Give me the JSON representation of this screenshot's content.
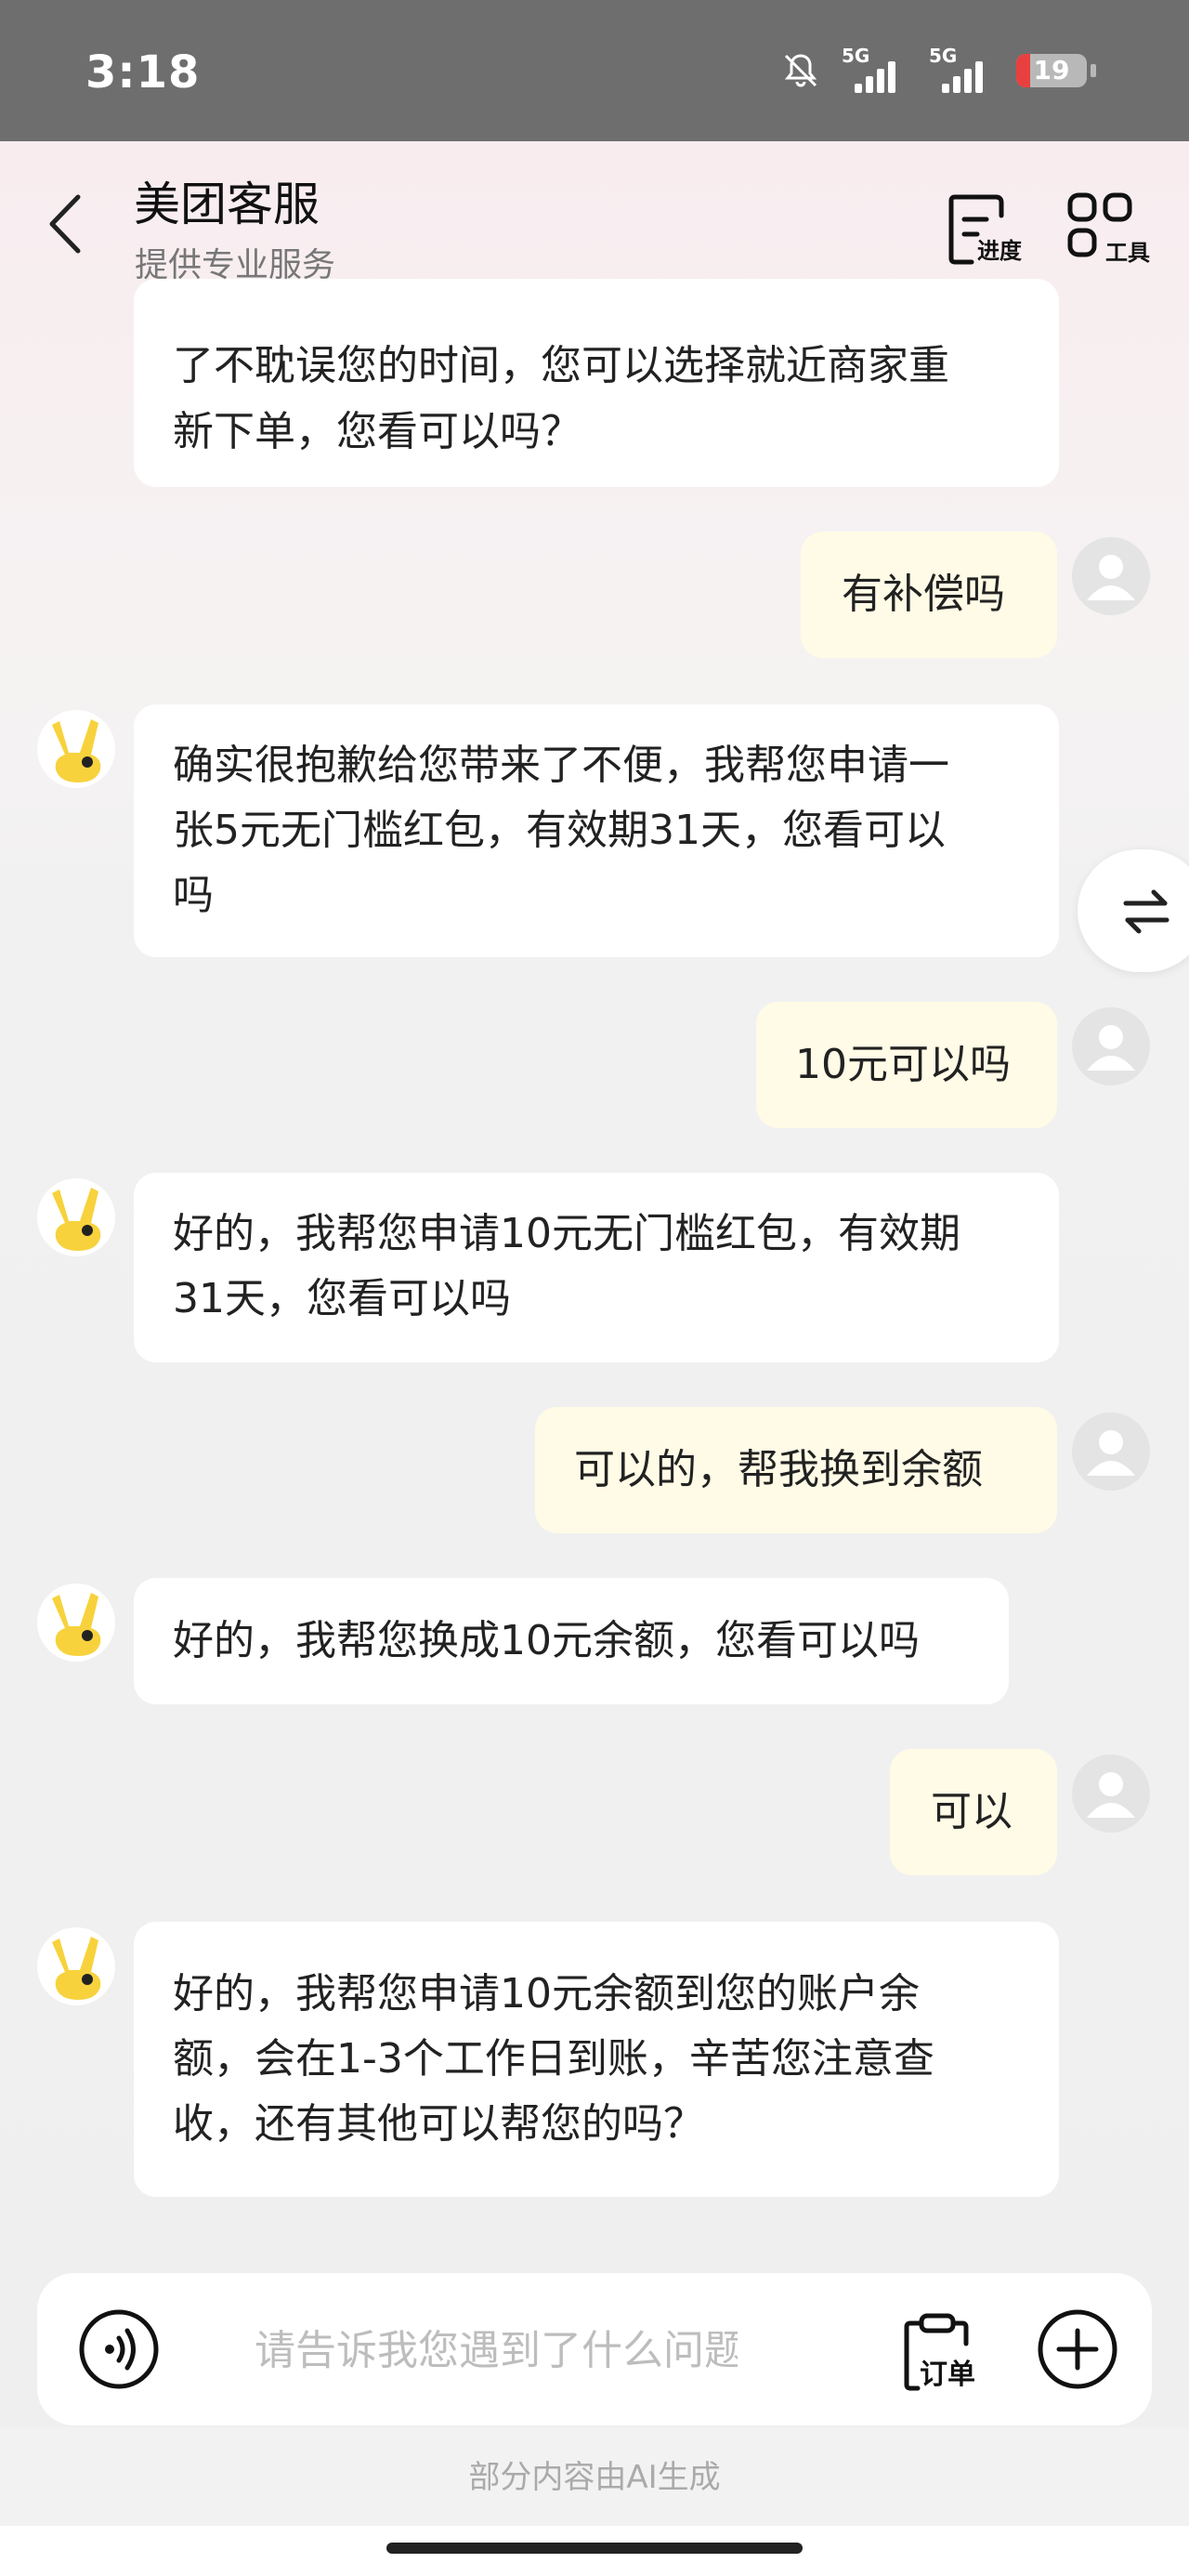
{
  "status_bar": {
    "time": "3:18",
    "signal_1_label": "5G",
    "signal_2_label": "5G",
    "battery": "19",
    "battery_color": "#e8403e",
    "icons": [
      "bell-off-icon",
      "signal-icon",
      "signal-icon",
      "battery-icon"
    ]
  },
  "header": {
    "title": "美团客服",
    "subtitle": "提供专业服务",
    "progress_label": "进度",
    "tools_label": "工具"
  },
  "messages": [
    {
      "role": "agent",
      "lines": [
        "了不耽误您的时间，您可以选择就近商家重",
        "新下单，您看可以吗？"
      ],
      "partial": true
    },
    {
      "role": "user",
      "lines": [
        "有补偿吗"
      ]
    },
    {
      "role": "agent",
      "lines": [
        "确实很抱歉给您带来了不便，我帮您申请一",
        "张5元无门槛红包，有效期31天，您看可以",
        "吗"
      ]
    },
    {
      "role": "user",
      "lines": [
        "10元可以吗"
      ]
    },
    {
      "role": "agent",
      "lines": [
        "好的，我帮您申请10元无门槛红包，有效期",
        "31天，您看可以吗"
      ]
    },
    {
      "role": "user",
      "lines": [
        "可以的，帮我换到余额"
      ]
    },
    {
      "role": "agent",
      "lines": [
        "好的，我帮您换成10元余额，您看可以吗"
      ]
    },
    {
      "role": "user",
      "lines": [
        "可以"
      ]
    },
    {
      "role": "agent",
      "lines": [
        "好的，我帮您申请10元余额到您的账户余",
        "额，会在1-3个工作日到账，辛苦您注意查",
        "收，还有其他可以帮您的吗？"
      ]
    }
  ],
  "input": {
    "placeholder": "请告诉我您遇到了什么问题",
    "order_label": "订单"
  },
  "footer_note": "部分内容由AI生成",
  "colors": {
    "agent_bubble": "#ffffff",
    "user_bubble": "#fffbe6",
    "mascot": "#f7d23c"
  }
}
